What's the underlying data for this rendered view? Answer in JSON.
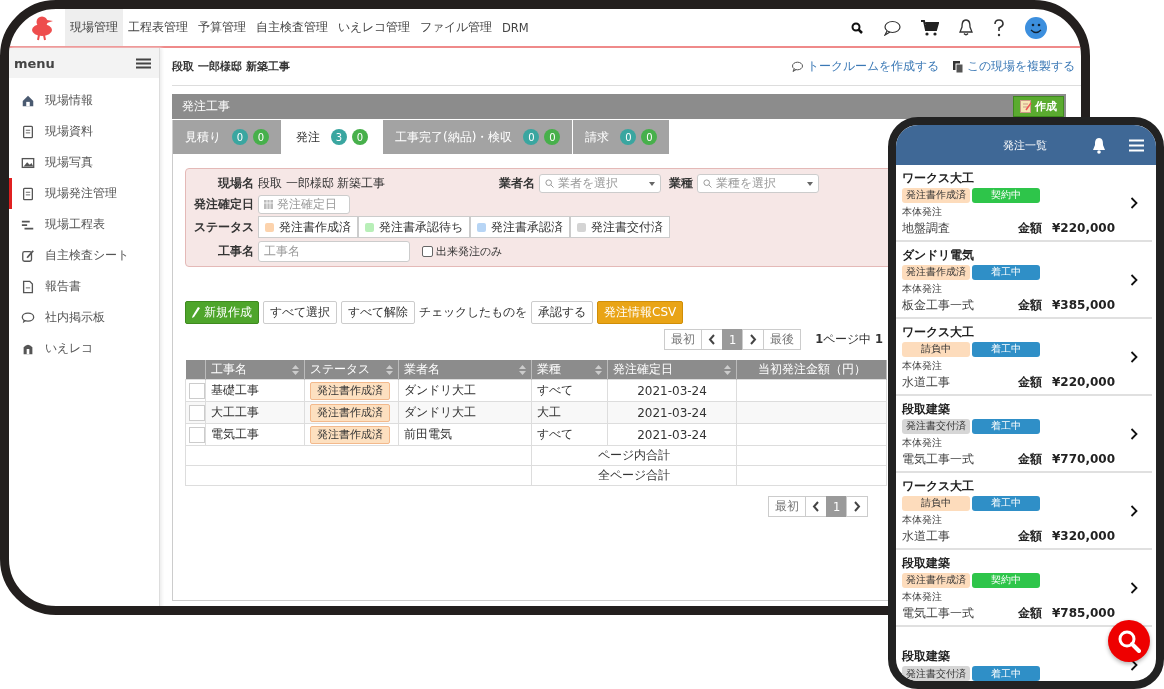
{
  "app_nav": {
    "items": [
      {
        "label": "現場管理",
        "selected": true
      },
      {
        "label": "工程表管理",
        "selected": false
      },
      {
        "label": "予算管理",
        "selected": false
      },
      {
        "label": "自主検査管理",
        "selected": false
      },
      {
        "label": "いえレコ管理",
        "selected": false
      },
      {
        "label": "ファイル管理",
        "selected": false
      },
      {
        "label": "DRM",
        "selected": false
      }
    ]
  },
  "sidebar": {
    "title": "menu",
    "items": [
      {
        "label": "現場情報",
        "selected": false
      },
      {
        "label": "現場資料",
        "selected": false
      },
      {
        "label": "現場写真",
        "selected": false
      },
      {
        "label": "現場発注管理",
        "selected": true
      },
      {
        "label": "現場工程表",
        "selected": false
      },
      {
        "label": "自主検査シート",
        "selected": false
      },
      {
        "label": "報告書",
        "selected": false
      },
      {
        "label": "社内掲示板",
        "selected": false
      },
      {
        "label": "いえレコ",
        "selected": false
      }
    ]
  },
  "page": {
    "title": "段取 一郎様邸 新築工事",
    "links": [
      "トークルームを作成する",
      "この現場を複製する"
    ]
  },
  "panel": {
    "title": "発注工事",
    "create_button": "作成",
    "tabs": [
      {
        "label": "見積り",
        "count_a": "0",
        "count_b": "0",
        "selected": false
      },
      {
        "label": "発注",
        "count_a": "3",
        "count_b": "0",
        "selected": true
      },
      {
        "label": "工事完了(納品)・検収",
        "count_a": "0",
        "count_b": "0",
        "selected": false
      },
      {
        "label": "請求",
        "count_a": "0",
        "count_b": "0",
        "selected": false
      }
    ]
  },
  "filters": {
    "site_label": "現場名",
    "site_value": "段取 一郎様邸 新築工事",
    "vendor_label": "業者名",
    "vendor_placeholder": "業者を選択",
    "trade_label": "業種",
    "trade_placeholder": "業種を選択",
    "date_label": "発注確定日",
    "date_placeholder": "発注確定日",
    "status_label": "ステータス",
    "statuses": [
      {
        "label": "発注書作成済",
        "color": "#fcd3ad"
      },
      {
        "label": "発注書承認待ち",
        "color": "#b8efb8"
      },
      {
        "label": "発注書承認済",
        "color": "#b7d5f5"
      },
      {
        "label": "発注書交付済",
        "color": "#d4d4d4"
      }
    ],
    "name_label": "工事名",
    "name_placeholder": "工事名",
    "done_only": {
      "label": "出来発注のみ",
      "checked": false
    }
  },
  "actions": [
    {
      "kind": "primary",
      "label": "新規作成"
    },
    {
      "kind": "default",
      "label": "すべて選択"
    },
    {
      "kind": "default",
      "label": "すべて解除"
    },
    {
      "kind": "text",
      "label": "チェックしたものを"
    },
    {
      "kind": "default",
      "label": "承認する"
    },
    {
      "kind": "warning",
      "label": "発注情報CSV"
    }
  ],
  "pager": {
    "first": "最初",
    "page": "1",
    "last": "最後",
    "summary": "**1**ページ中 **1**"
  },
  "table": {
    "columns": [
      {
        "label": "工事名",
        "sortable": true
      },
      {
        "label": "ステータス",
        "sortable": true
      },
      {
        "label": "業者名",
        "sortable": true
      },
      {
        "label": "業種",
        "sortable": true
      },
      {
        "label": "発注確定日",
        "sortable": true
      },
      {
        "label": "当初発注金額（円）",
        "sortable": false
      }
    ],
    "rows": [
      {
        "checked": false,
        "name": "基礎工事",
        "status": "発注書作成済",
        "vendor": "ダンドリ大工",
        "trade": "すべて",
        "date": "2021-03-24"
      },
      {
        "checked": false,
        "name": "大工工事",
        "status": "発注書作成済",
        "vendor": "ダンドリ大工",
        "trade": "大工",
        "date": "2021-03-24"
      },
      {
        "checked": false,
        "name": "電気工事",
        "status": "発注書作成済",
        "vendor": "前田電気",
        "trade": "すべて",
        "date": "2021-03-24"
      }
    ],
    "totals": [
      "ページ内合計",
      "全ページ合計"
    ]
  },
  "bottom_pager": {
    "first": "最初",
    "page": "1"
  },
  "phone": {
    "title": "発注一覧",
    "orders": [
      {
        "vendor": "ワークス大工",
        "tags": [
          {
            "label": "発注書作成済",
            "color": "#fddcbc"
          },
          {
            "label": "契約中",
            "color": "#2ec54a"
          }
        ],
        "category": "本体発注",
        "work": "地盤調査",
        "amount_label": "金額",
        "amount": "¥220,000"
      },
      {
        "vendor": "ダンドリ電気",
        "tags": [
          {
            "label": "発注書作成済",
            "color": "#fddcbc"
          },
          {
            "label": "着工中",
            "color": "#2f8fc7"
          }
        ],
        "category": "本体発注",
        "work": "板金工事一式",
        "amount_label": "金額",
        "amount": "¥385,000"
      },
      {
        "vendor": "ワークス大工",
        "tags": [
          {
            "label": "請負中",
            "color": "#fddcbc"
          },
          {
            "label": "着工中",
            "color": "#2f8fc7"
          }
        ],
        "category": "本体発注",
        "work": "水道工事",
        "amount_label": "金額",
        "amount": "¥220,000"
      },
      {
        "vendor": "段取建築",
        "tags": [
          {
            "label": "発注書交付済",
            "color": "#d6d6d6"
          },
          {
            "label": "着工中",
            "color": "#2f8fc7"
          }
        ],
        "category": "本体発注",
        "work": "電気工事一式",
        "amount_label": "金額",
        "amount": "¥770,000"
      },
      {
        "vendor": "ワークス大工",
        "tags": [
          {
            "label": "請負中",
            "color": "#fddcbc"
          },
          {
            "label": "着工中",
            "color": "#2f8fc7"
          }
        ],
        "category": "本体発注",
        "work": "水道工事",
        "amount_label": "金額",
        "amount": "¥320,000"
      },
      {
        "vendor": "段取建築",
        "tags": [
          {
            "label": "発注書作成済",
            "color": "#fddcbc"
          },
          {
            "label": "契約中",
            "color": "#2ec54a"
          }
        ],
        "category": "本体発注",
        "work": "電気工事一式",
        "amount_label": "金額",
        "amount": "¥785,000"
      },
      {
        "vendor": "段取建築",
        "tags": [
          {
            "label": "発注書交付済",
            "color": "#d6d6d6"
          },
          {
            "label": "着工中",
            "color": "#2f8fc7"
          }
        ]
      }
    ]
  }
}
